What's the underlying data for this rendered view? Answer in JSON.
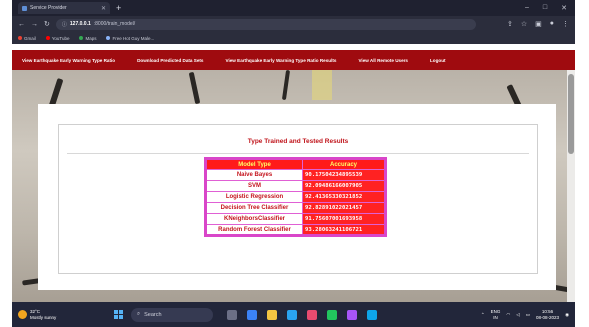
{
  "browser": {
    "tab_title": "Service Provider",
    "url_host": "127.0.0.1",
    "url_path": ":8000/train_model/",
    "bookmarks": [
      "Gmail",
      "YouTube",
      "Maps",
      "Free Hot Guy Male..."
    ]
  },
  "nav": {
    "items": [
      "View Earthquake Early Warning Type Ratio",
      "Download Predicted Data Sets",
      "View Earthquake Early Warning Type Ratio Results",
      "View All Remote Users",
      "Logout"
    ]
  },
  "panel": {
    "title": "Type Trained and Tested Results"
  },
  "results": {
    "headers": [
      "Model Type",
      "Accuracy"
    ],
    "rows": [
      {
        "model": "Naive Bayes",
        "accuracy": "90.17504234895539"
      },
      {
        "model": "SVM",
        "accuracy": "92.09486166007905"
      },
      {
        "model": "Logistic Regression",
        "accuracy": "92.41365330321852"
      },
      {
        "model": "Decision Tree Classifier",
        "accuracy": "92.82891022021457"
      },
      {
        "model": "KNeighborsClassifier",
        "accuracy": "91.75607001693958"
      },
      {
        "model": "Random Forest Classifier",
        "accuracy": "93.28063241106721"
      }
    ]
  },
  "taskbar": {
    "weather_temp": "32°C",
    "weather_desc": "Mostly sunny",
    "search_placeholder": "Search",
    "lang": "ENG",
    "region": "IN",
    "time": "10:56",
    "date": "08-08-2023"
  },
  "colors": {
    "nav_bg": "#9f0b0f",
    "title_red": "#c0141b",
    "table_header": "#ff1a1a",
    "table_border": "#d946c9"
  }
}
